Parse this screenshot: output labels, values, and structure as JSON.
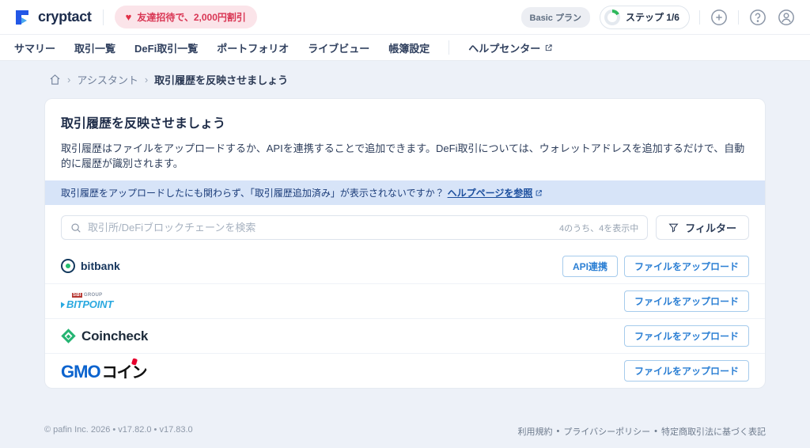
{
  "header": {
    "brand": "cryptact",
    "referral_badge": "友達招待で、2,000円割引",
    "plan_badge": "Basic プラン",
    "step_label": "ステップ 1/6"
  },
  "icons": {
    "heart": "♥",
    "breadcrumb_separator": "›",
    "dot_separator": "•"
  },
  "nav": {
    "items": [
      {
        "label": "サマリー"
      },
      {
        "label": "取引一覧"
      },
      {
        "label": "DeFi取引一覧"
      },
      {
        "label": "ポートフォリオ"
      },
      {
        "label": "ライブビュー"
      },
      {
        "label": "帳簿設定"
      }
    ],
    "help": "ヘルプセンター"
  },
  "breadcrumb": {
    "parent": "アシスタント",
    "current": "取引履歴を反映させましょう"
  },
  "main": {
    "title": "取引履歴を反映させましょう",
    "description": "取引履歴はファイルをアップロードするか、APIを連携することで追加できます。DeFi取引については、ウォレットアドレスを追加するだけで、自動的に履歴が識別されます。",
    "notice": {
      "text": "取引履歴をアップロードしたにも関わらず、「取引履歴追加済み」が表示されないですか？",
      "link": "ヘルプページを参照"
    },
    "search": {
      "placeholder": "取引所/DeFiブロックチェーンを検索",
      "count": "4のうち、4を表示中",
      "filter_label": "フィルター"
    },
    "buttons": {
      "api": "API連携",
      "upload": "ファイルをアップロード"
    },
    "exchanges": [
      {
        "name": "bitbank"
      },
      {
        "name": "BITPOINT",
        "group": "SBI",
        "group2": "GROUP"
      },
      {
        "name": "Coincheck"
      },
      {
        "name": "GMOコイン",
        "part_blue": "GMO",
        "part_black": "コイン"
      }
    ]
  },
  "footer": {
    "left": "© pafin Inc. 2026 • v17.82.0 • v17.83.0",
    "links": [
      {
        "label": "利用規約"
      },
      {
        "label": "プライバシーポリシー"
      },
      {
        "label": "特定商取引法に基づく表記"
      }
    ]
  },
  "colors": {
    "accent_blue": "#2b7fd4",
    "brand_navy": "#1c2c4c",
    "notice_bg": "#d7e4f8",
    "badge_pink": "#fbe4e9",
    "badge_red": "#d93654",
    "progress_green": "#2eb85c",
    "page_bg": "#edf1f8"
  }
}
